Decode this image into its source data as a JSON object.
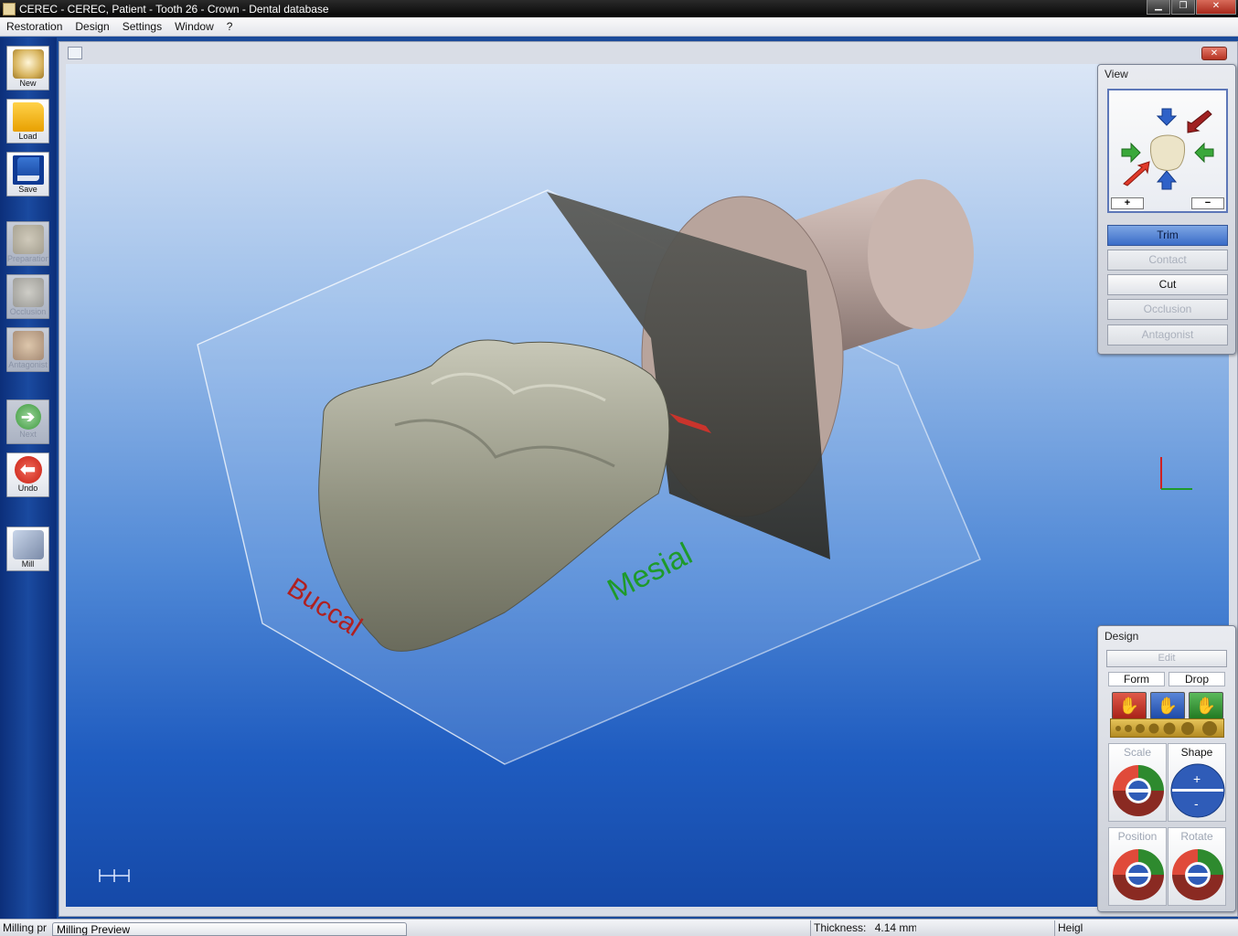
{
  "window": {
    "title": "CEREC - CEREC, Patient - Tooth  26 - Crown - Dental database",
    "controls": [
      "minimize",
      "restore",
      "close"
    ]
  },
  "menu": [
    "Restoration",
    "Design",
    "Settings",
    "Window",
    "?"
  ],
  "toolbar": {
    "new": "New",
    "load": "Load",
    "save": "Save",
    "preparation": "Preparation",
    "occlusion": "Occlusion",
    "antagonist": "Antagonist",
    "next": "Next",
    "undo": "Undo",
    "mill": "Mill"
  },
  "viewport": {
    "buccal_label": "Buccal",
    "mesial_label": "Mesial",
    "colors": {
      "buccal": "#b02020",
      "mesial": "#1e9a2a"
    }
  },
  "view_panel": {
    "title": "View",
    "zoom_in": "+",
    "zoom_out": "−",
    "buttons": [
      "Trim",
      "Contact",
      "Cut",
      "Occlusion",
      "Antagonist"
    ]
  },
  "design_panel": {
    "title": "Design",
    "edit": "Edit",
    "form": "Form",
    "drop": "Drop",
    "scale": "Scale",
    "shape": "Shape",
    "shape_plus": "+",
    "shape_minus": "-",
    "position": "Position",
    "rotate": "Rotate"
  },
  "statusbar": {
    "left": "Milling pr",
    "task": "Milling Preview",
    "thickness_label": "Thickness:",
    "thickness_value": "4.14 mm",
    "height": "Heigl"
  }
}
